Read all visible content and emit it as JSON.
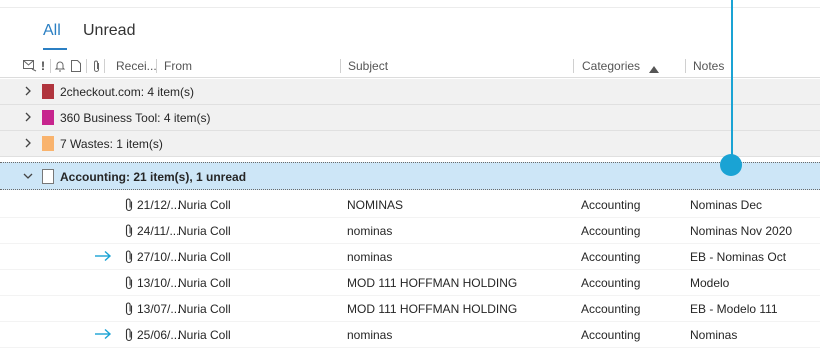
{
  "tabs": {
    "all": "All",
    "unread": "Unread"
  },
  "columns": {
    "received": "Recei...",
    "from": "From",
    "subject": "Subject",
    "categories": "Categories",
    "notes": "Notes"
  },
  "colors": {
    "accent": "#2b7fc3",
    "pointer": "#1aa3d4",
    "selected_row": "#cde6f7"
  },
  "groups": [
    {
      "title": "2checkout.com: 4 item(s)",
      "color": "#b0343d"
    },
    {
      "title": "360 Business Tool: 4 item(s)",
      "color": "#c7258e"
    },
    {
      "title": "7 Wastes: 1 item(s)",
      "color": "#f9b36d"
    },
    {
      "title": "Accounting: 21 item(s), 1 unread",
      "color": "#ffffff"
    }
  ],
  "messages": [
    {
      "received": "21/12/...",
      "from": "Nuria Coll",
      "subject": "NOMINAS",
      "category": "Accounting",
      "notes": "Nominas Dec",
      "forwarded": false
    },
    {
      "received": "24/11/...",
      "from": "Nuria Coll",
      "subject": "nominas",
      "category": "Accounting",
      "notes": "Nominas Nov 2020",
      "forwarded": false
    },
    {
      "received": "27/10/...",
      "from": "Nuria Coll",
      "subject": "nominas",
      "category": "Accounting",
      "notes": "EB - Nominas Oct",
      "forwarded": true
    },
    {
      "received": "13/10/...",
      "from": "Nuria Coll",
      "subject": "MOD 111 HOFFMAN HOLDING",
      "category": "Accounting",
      "notes": "Modelo",
      "forwarded": false
    },
    {
      "received": "13/07/...",
      "from": "Nuria Coll",
      "subject": "MOD 111 HOFFMAN HOLDING",
      "category": "Accounting",
      "notes": "EB - Modelo 111",
      "forwarded": false
    },
    {
      "received": "25/06/...",
      "from": "Nuria Coll",
      "subject": "nominas",
      "category": "Accounting",
      "notes": "Nominas",
      "forwarded": true
    }
  ]
}
